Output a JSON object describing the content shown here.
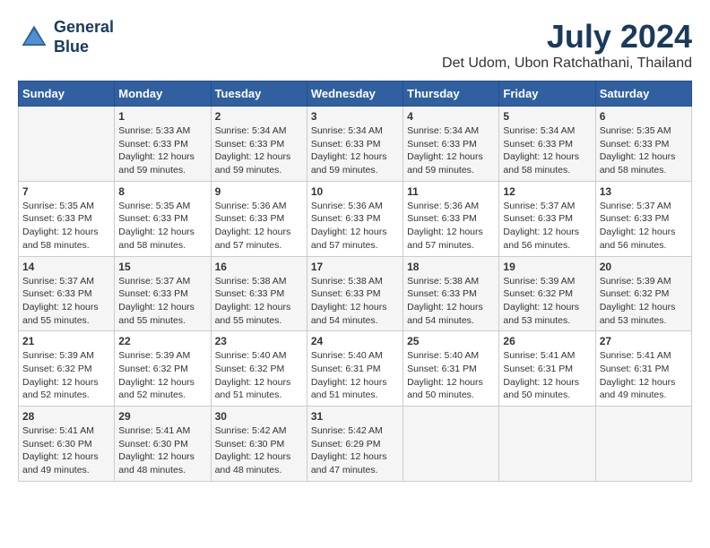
{
  "logo": {
    "line1": "General",
    "line2": "Blue"
  },
  "title": {
    "month_year": "July 2024",
    "location": "Det Udom, Ubon Ratchathani, Thailand"
  },
  "weekdays": [
    "Sunday",
    "Monday",
    "Tuesday",
    "Wednesday",
    "Thursday",
    "Friday",
    "Saturday"
  ],
  "weeks": [
    [
      {
        "day": "",
        "info": ""
      },
      {
        "day": "1",
        "info": "Sunrise: 5:33 AM\nSunset: 6:33 PM\nDaylight: 12 hours\nand 59 minutes."
      },
      {
        "day": "2",
        "info": "Sunrise: 5:34 AM\nSunset: 6:33 PM\nDaylight: 12 hours\nand 59 minutes."
      },
      {
        "day": "3",
        "info": "Sunrise: 5:34 AM\nSunset: 6:33 PM\nDaylight: 12 hours\nand 59 minutes."
      },
      {
        "day": "4",
        "info": "Sunrise: 5:34 AM\nSunset: 6:33 PM\nDaylight: 12 hours\nand 59 minutes."
      },
      {
        "day": "5",
        "info": "Sunrise: 5:34 AM\nSunset: 6:33 PM\nDaylight: 12 hours\nand 58 minutes."
      },
      {
        "day": "6",
        "info": "Sunrise: 5:35 AM\nSunset: 6:33 PM\nDaylight: 12 hours\nand 58 minutes."
      }
    ],
    [
      {
        "day": "7",
        "info": "Sunrise: 5:35 AM\nSunset: 6:33 PM\nDaylight: 12 hours\nand 58 minutes."
      },
      {
        "day": "8",
        "info": "Sunrise: 5:35 AM\nSunset: 6:33 PM\nDaylight: 12 hours\nand 58 minutes."
      },
      {
        "day": "9",
        "info": "Sunrise: 5:36 AM\nSunset: 6:33 PM\nDaylight: 12 hours\nand 57 minutes."
      },
      {
        "day": "10",
        "info": "Sunrise: 5:36 AM\nSunset: 6:33 PM\nDaylight: 12 hours\nand 57 minutes."
      },
      {
        "day": "11",
        "info": "Sunrise: 5:36 AM\nSunset: 6:33 PM\nDaylight: 12 hours\nand 57 minutes."
      },
      {
        "day": "12",
        "info": "Sunrise: 5:37 AM\nSunset: 6:33 PM\nDaylight: 12 hours\nand 56 minutes."
      },
      {
        "day": "13",
        "info": "Sunrise: 5:37 AM\nSunset: 6:33 PM\nDaylight: 12 hours\nand 56 minutes."
      }
    ],
    [
      {
        "day": "14",
        "info": "Sunrise: 5:37 AM\nSunset: 6:33 PM\nDaylight: 12 hours\nand 55 minutes."
      },
      {
        "day": "15",
        "info": "Sunrise: 5:37 AM\nSunset: 6:33 PM\nDaylight: 12 hours\nand 55 minutes."
      },
      {
        "day": "16",
        "info": "Sunrise: 5:38 AM\nSunset: 6:33 PM\nDaylight: 12 hours\nand 55 minutes."
      },
      {
        "day": "17",
        "info": "Sunrise: 5:38 AM\nSunset: 6:33 PM\nDaylight: 12 hours\nand 54 minutes."
      },
      {
        "day": "18",
        "info": "Sunrise: 5:38 AM\nSunset: 6:33 PM\nDaylight: 12 hours\nand 54 minutes."
      },
      {
        "day": "19",
        "info": "Sunrise: 5:39 AM\nSunset: 6:32 PM\nDaylight: 12 hours\nand 53 minutes."
      },
      {
        "day": "20",
        "info": "Sunrise: 5:39 AM\nSunset: 6:32 PM\nDaylight: 12 hours\nand 53 minutes."
      }
    ],
    [
      {
        "day": "21",
        "info": "Sunrise: 5:39 AM\nSunset: 6:32 PM\nDaylight: 12 hours\nand 52 minutes."
      },
      {
        "day": "22",
        "info": "Sunrise: 5:39 AM\nSunset: 6:32 PM\nDaylight: 12 hours\nand 52 minutes."
      },
      {
        "day": "23",
        "info": "Sunrise: 5:40 AM\nSunset: 6:32 PM\nDaylight: 12 hours\nand 51 minutes."
      },
      {
        "day": "24",
        "info": "Sunrise: 5:40 AM\nSunset: 6:31 PM\nDaylight: 12 hours\nand 51 minutes."
      },
      {
        "day": "25",
        "info": "Sunrise: 5:40 AM\nSunset: 6:31 PM\nDaylight: 12 hours\nand 50 minutes."
      },
      {
        "day": "26",
        "info": "Sunrise: 5:41 AM\nSunset: 6:31 PM\nDaylight: 12 hours\nand 50 minutes."
      },
      {
        "day": "27",
        "info": "Sunrise: 5:41 AM\nSunset: 6:31 PM\nDaylight: 12 hours\nand 49 minutes."
      }
    ],
    [
      {
        "day": "28",
        "info": "Sunrise: 5:41 AM\nSunset: 6:30 PM\nDaylight: 12 hours\nand 49 minutes."
      },
      {
        "day": "29",
        "info": "Sunrise: 5:41 AM\nSunset: 6:30 PM\nDaylight: 12 hours\nand 48 minutes."
      },
      {
        "day": "30",
        "info": "Sunrise: 5:42 AM\nSunset: 6:30 PM\nDaylight: 12 hours\nand 48 minutes."
      },
      {
        "day": "31",
        "info": "Sunrise: 5:42 AM\nSunset: 6:29 PM\nDaylight: 12 hours\nand 47 minutes."
      },
      {
        "day": "",
        "info": ""
      },
      {
        "day": "",
        "info": ""
      },
      {
        "day": "",
        "info": ""
      }
    ]
  ]
}
